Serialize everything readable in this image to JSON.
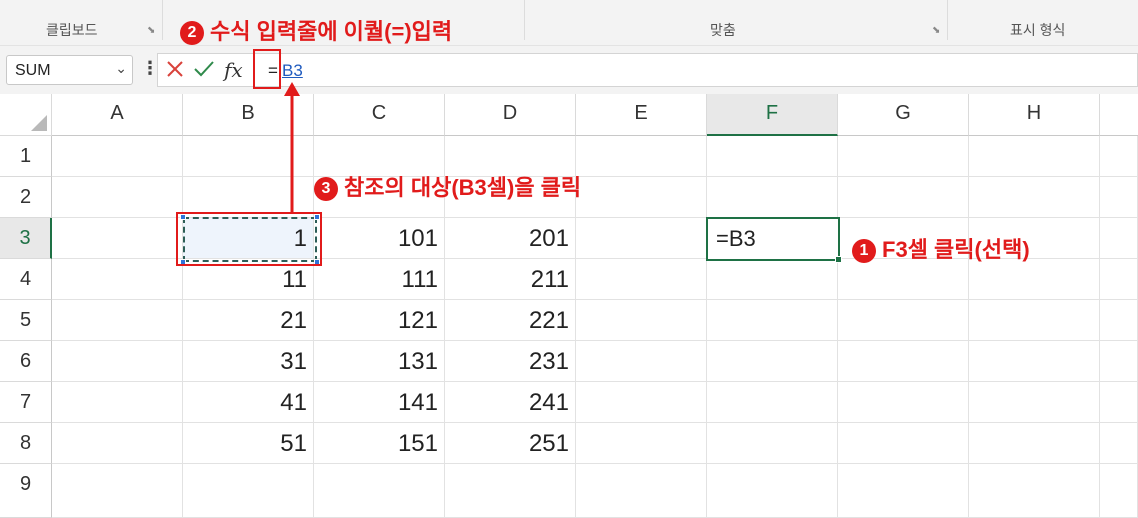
{
  "ribbon": {
    "groups": [
      {
        "label": "클립보드"
      },
      {
        "label": "맞춤"
      },
      {
        "label": "표시 형식"
      }
    ],
    "launcher_glyph": "⬊"
  },
  "formula_bar": {
    "name_box": "SUM",
    "name_box_dropdown_glyph": "⌄",
    "dots_glyph": "⋮",
    "fx_label": "fx",
    "formula_eq": "=",
    "formula_ref": "B3"
  },
  "grid": {
    "columns": [
      "A",
      "B",
      "C",
      "D",
      "E",
      "F",
      "G",
      "H"
    ],
    "rows": [
      "1",
      "2",
      "3",
      "4",
      "5",
      "6",
      "7",
      "8",
      "9"
    ],
    "values": {
      "B": [
        "1",
        "11",
        "21",
        "31",
        "41",
        "51"
      ],
      "C": [
        "101",
        "111",
        "121",
        "131",
        "141",
        "151"
      ],
      "D": [
        "201",
        "211",
        "221",
        "231",
        "241",
        "251"
      ]
    },
    "active_cell_text": "=B3"
  },
  "annotations": {
    "step1": {
      "num": "1",
      "text": "F3셀 클릭(선택)"
    },
    "step2": {
      "num": "2",
      "text": "수식 입력줄에 이퀄(=)입력"
    },
    "step3": {
      "num": "3",
      "text": "참조의 대상(B3셀)을 클릭"
    }
  },
  "colors": {
    "annotation_red": "#e11b1b",
    "excel_green": "#1e7145",
    "reference_blue": "#1f5bbf"
  }
}
